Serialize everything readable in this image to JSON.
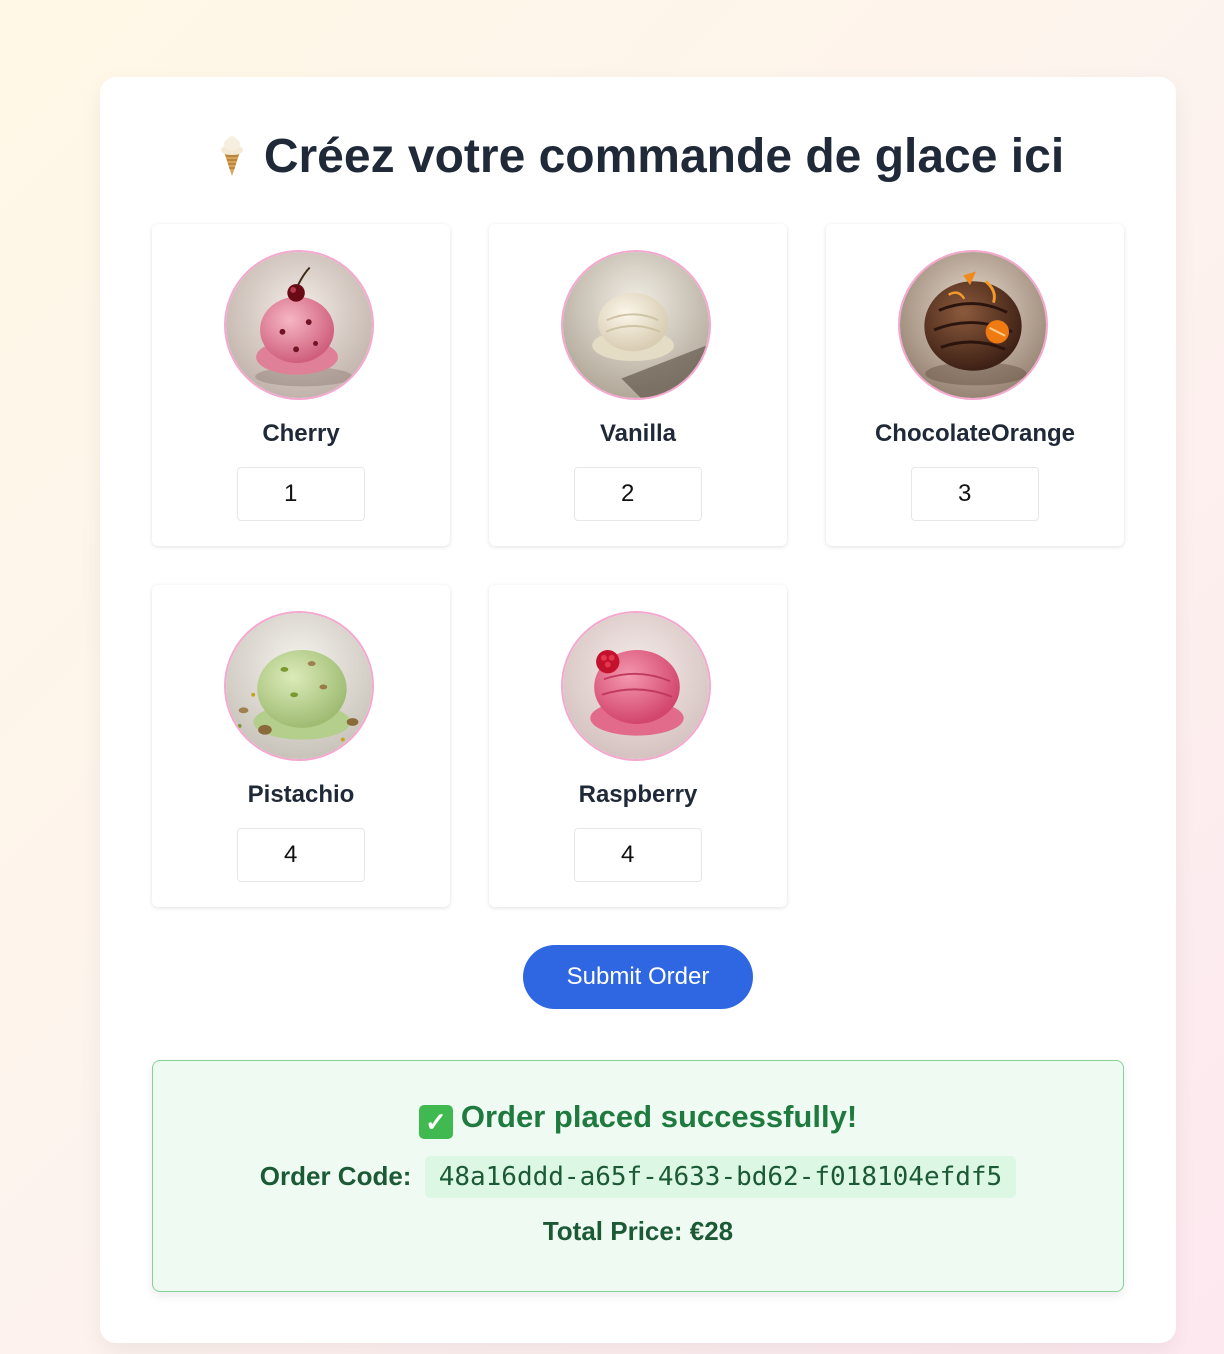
{
  "page": {
    "title": "Créez votre commande de glace ici",
    "title_icon": "ice-cream-cone-icon"
  },
  "flavors": [
    {
      "name": "Cherry",
      "quantity": "1",
      "image": "cherry-ice-cream-scoop"
    },
    {
      "name": "Vanilla",
      "quantity": "2",
      "image": "vanilla-ice-cream-scoop"
    },
    {
      "name": "ChocolateOrange",
      "quantity": "3",
      "image": "chocolate-orange-ice-cream-scoop"
    },
    {
      "name": "Pistachio",
      "quantity": "4",
      "image": "pistachio-ice-cream-scoop"
    },
    {
      "name": "Raspberry",
      "quantity": "4",
      "image": "raspberry-ice-cream-scoop"
    }
  ],
  "submit": {
    "label": "Submit Order"
  },
  "result": {
    "icon": "check-mark-icon",
    "heading": "Order placed successfully!",
    "code_label": "Order Code:",
    "code_value": "48a16ddd-a65f-4633-bd62-f018104efdf5",
    "total_label": "Total Price:",
    "total_value": "€28"
  },
  "colors": {
    "accent": "#2f67e2",
    "success_bg": "#effbf2",
    "success_border": "#86d39a",
    "photo_border": "#f4a7cf"
  }
}
